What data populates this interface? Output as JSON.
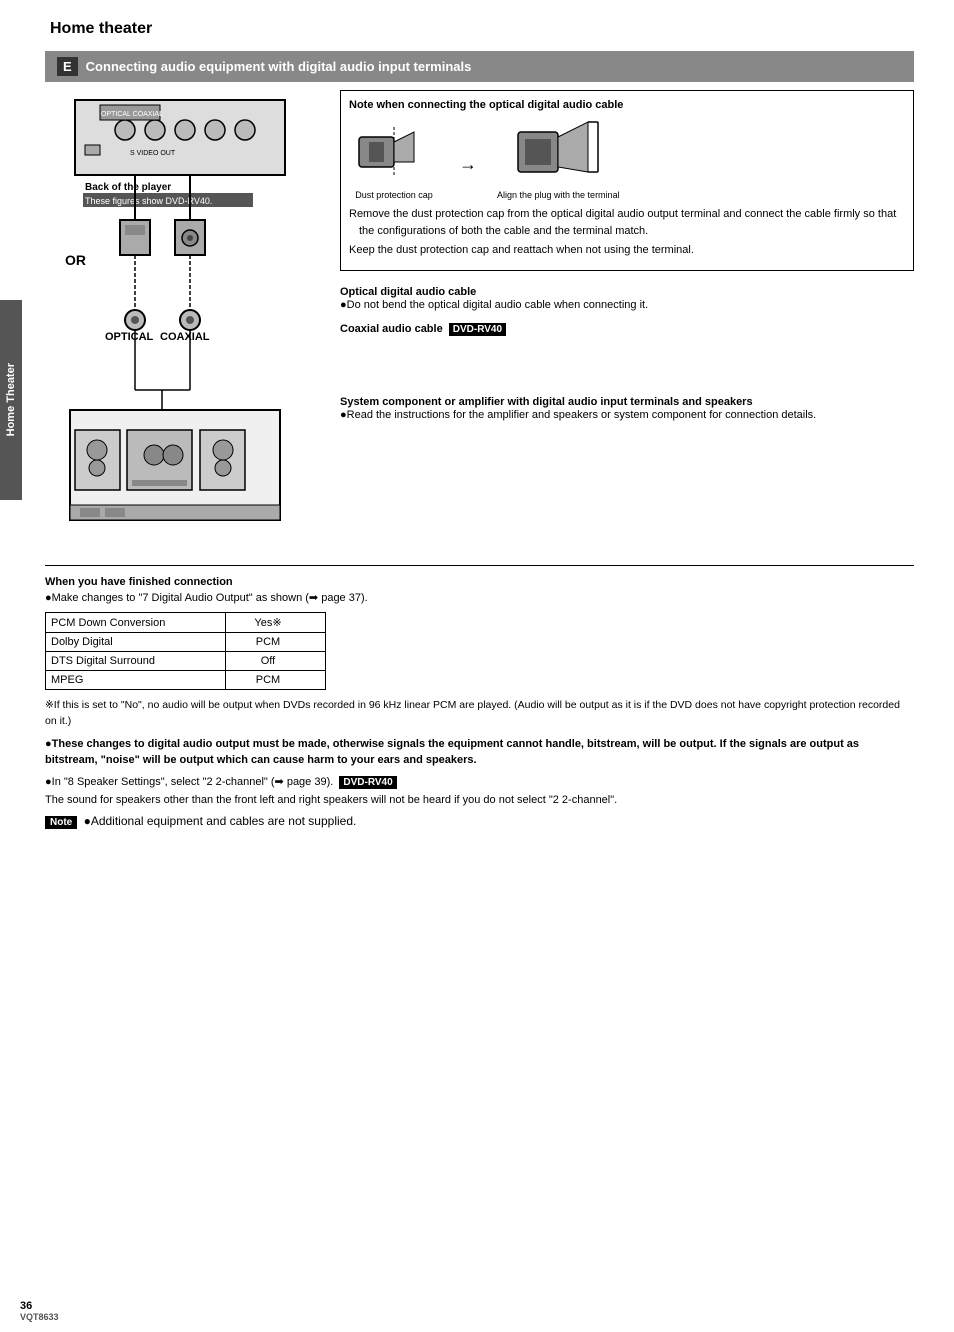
{
  "page": {
    "title": "Home theater",
    "page_number": "36",
    "footer_code": "VQT8633"
  },
  "section": {
    "letter": "E",
    "title": "Connecting audio equipment with digital audio input terminals"
  },
  "side_label": "Home Theater",
  "note_box": {
    "title": "Note when connecting the optical digital audio cable",
    "dust_label": "Dust protection cap",
    "align_label": "Align the plug with the terminal",
    "bullet1": "Remove the dust protection cap from the optical digital audio output terminal and connect the cable firmly so that the configurations of both the cable and the terminal match.",
    "bullet2": "Keep the dust protection cap and reattach when not using the terminal."
  },
  "labels": {
    "optical_cable_title": "Optical digital audio cable",
    "optical_cable_text": "●Do not bend the optical digital audio cable when connecting it.",
    "coaxial_cable_title": "Coaxial audio cable",
    "coaxial_badge": "DVD-RV40",
    "system_title": "System component or amplifier with digital audio input terminals and speakers",
    "system_text": "●Read the instructions for the amplifier and speakers or system component for connection details."
  },
  "diagram": {
    "back_of_player": "Back of the player",
    "model_label": "These figures show DVD-RV40.",
    "or_label": "OR",
    "optical_label": "OPTICAL",
    "coaxial_label": "COAXIAL"
  },
  "finish_section": {
    "title": "When you have finished connection",
    "text": "●Make changes to \"7 Digital Audio Output\" as shown (➡ page 37).",
    "table": {
      "rows": [
        {
          "setting": "PCM Down Conversion",
          "value": "Yes※"
        },
        {
          "setting": "Dolby Digital",
          "value": "PCM"
        },
        {
          "setting": "DTS Digital Surround",
          "value": "Off"
        },
        {
          "setting": "MPEG",
          "value": "PCM"
        }
      ]
    },
    "footnote1": "※If this is set to \"No\", no audio will be output when DVDs recorded in 96 kHz linear PCM are played. (Audio will be output as it is if the DVD does not have copyright protection recorded on it.)",
    "footnote2_bold": "●These changes to digital audio output must be made, otherwise signals the equipment cannot handle, bitstream, will be output. If the signals are output as bitstream, \"noise\" will be output which can cause harm to your ears and speakers.",
    "footnote3": "●In \"8 Speaker Settings\", select \"2 2-channel\" (➡ page 39).",
    "footnote3_badge": "DVD-RV40",
    "footnote3_text": "The sound for speakers other than the front left and right speakers will not be heard if you do not select \"2 2-channel\".",
    "note_tag": "Note",
    "note_text": "●Additional equipment and cables are not supplied."
  }
}
